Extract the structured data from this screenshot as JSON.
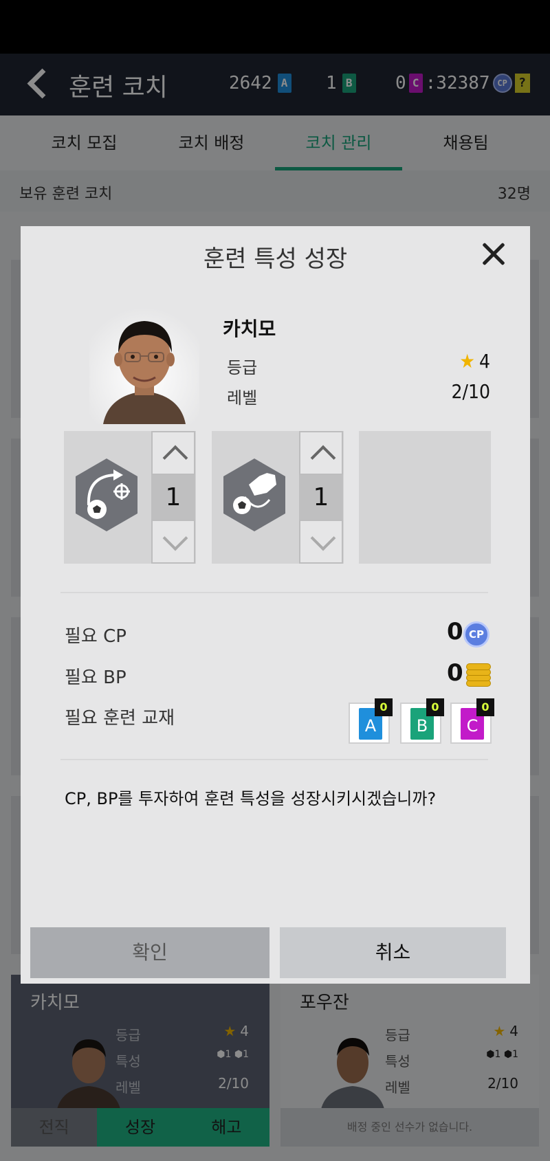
{
  "header": {
    "title": "훈련 코치",
    "currencies": [
      {
        "amount": "2642",
        "material": "A",
        "color": "#1f8fdc"
      },
      {
        "amount": "1",
        "material": "B",
        "color": "#1aa37a"
      },
      {
        "amount": "0",
        "material": "C",
        "color": "#c21bc9"
      }
    ],
    "cp_amount": ":32387",
    "cp_icon": "CP",
    "help_label": "?"
  },
  "tabs": [
    {
      "label": "코치 모집"
    },
    {
      "label": "코치 배정"
    },
    {
      "label": "코치 관리"
    },
    {
      "label": "채용팀"
    }
  ],
  "active_tab": "코치 관리",
  "summary": {
    "label": "보유 훈련 코치",
    "value": "32명"
  },
  "cards": [
    {
      "name": "카치모",
      "grade_label": "등급",
      "grade": "4",
      "trait_label": "특성",
      "trait_levels": [
        "1",
        "1"
      ],
      "level_label": "레벨",
      "level": "2/10",
      "actions": [
        "전직",
        "성장",
        "해고"
      ]
    },
    {
      "name": "포우잔",
      "grade_label": "등급",
      "grade": "4",
      "trait_label": "특성",
      "trait_levels": [
        "1",
        "1"
      ],
      "level_label": "레벨",
      "level": "2/10",
      "notice": "배정 중인 선수가 없습니다."
    }
  ],
  "modal": {
    "title": "훈련 특성 성장",
    "coach_name": "카치모",
    "grade_label": "등급",
    "grade_value": "4",
    "level_label": "레벨",
    "level_value": "2/10",
    "traits": [
      {
        "icon": "curve-shot-trait-icon",
        "value": "1"
      },
      {
        "icon": "kick-trait-icon",
        "value": "1"
      }
    ],
    "cost": {
      "cp_label": "필요 CP",
      "cp_value": "0",
      "cp_icon": "CP",
      "bp_label": "필요 BP",
      "bp_value": "0",
      "material_label": "필요 훈련 교재",
      "materials": [
        {
          "letter": "A",
          "count": "0",
          "color": "#1f8fdc"
        },
        {
          "letter": "B",
          "count": "0",
          "color": "#1aa37a"
        },
        {
          "letter": "C",
          "count": "0",
          "color": "#c21bc9"
        }
      ]
    },
    "question": "CP, BP를 투자하여 훈련 특성을 성장시키시겠습니까?",
    "confirm_label": "확인",
    "cancel_label": "취소"
  }
}
